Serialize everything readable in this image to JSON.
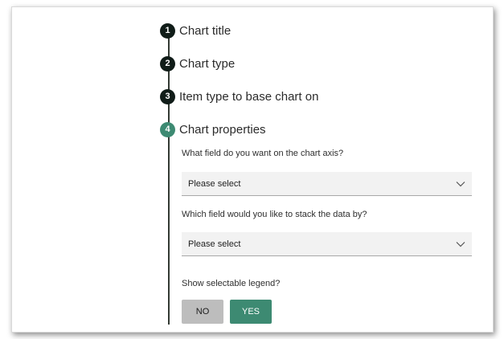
{
  "steps": [
    {
      "number": "1",
      "title": "Chart title"
    },
    {
      "number": "2",
      "title": "Chart type"
    },
    {
      "number": "3",
      "title": "Item type to base chart on"
    },
    {
      "number": "4",
      "title": "Chart properties"
    }
  ],
  "chart_properties": {
    "axis_field_label": "What field do you want on the chart axis?",
    "axis_field_value": "Please select",
    "stack_field_label": "Which field would you like to stack the data by?",
    "stack_field_value": "Please select",
    "legend_label": "Show selectable legend?",
    "legend_no": "NO",
    "legend_yes": "YES",
    "legend_selected": "YES"
  },
  "colors": {
    "active_step": "#3d8a72",
    "inactive_step": "#101c18",
    "selected_button": "#3d8a72",
    "unselected_button": "#bdbdbd"
  },
  "icons": {
    "select_arrow": "chevron-down-icon"
  }
}
